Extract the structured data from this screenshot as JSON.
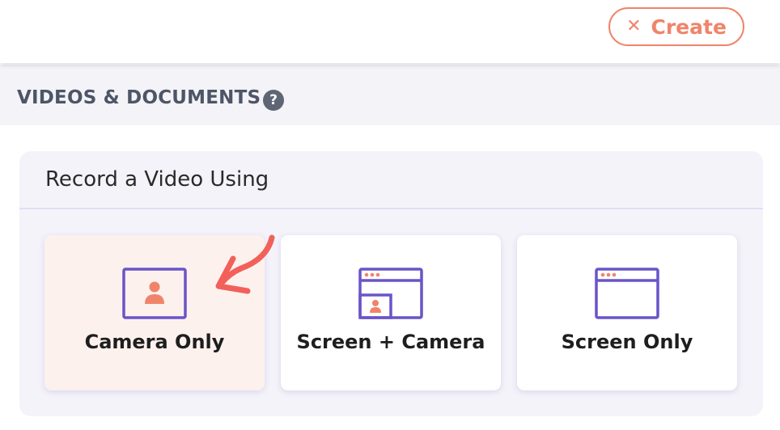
{
  "header": {
    "create_button": {
      "label": "Create",
      "icon": "close-icon",
      "color": "#f0846a"
    }
  },
  "section": {
    "title": "VIDEOS & DOCUMENTS",
    "help_icon": "question-icon",
    "help_glyph": "?"
  },
  "record_panel": {
    "title": "Record a Video Using",
    "options": [
      {
        "label": "Camera Only",
        "icon": "camera-frame-icon",
        "selected": true
      },
      {
        "label": "Screen + Camera",
        "icon": "screen-with-camera-icon",
        "selected": false
      },
      {
        "label": "Screen Only",
        "icon": "browser-window-icon",
        "selected": false
      }
    ]
  },
  "colors": {
    "accent": "#f0846a",
    "icon_stroke": "#6a54c8",
    "selected_bg": "#fdf1ee",
    "panel_bg": "#f4f3fa"
  }
}
